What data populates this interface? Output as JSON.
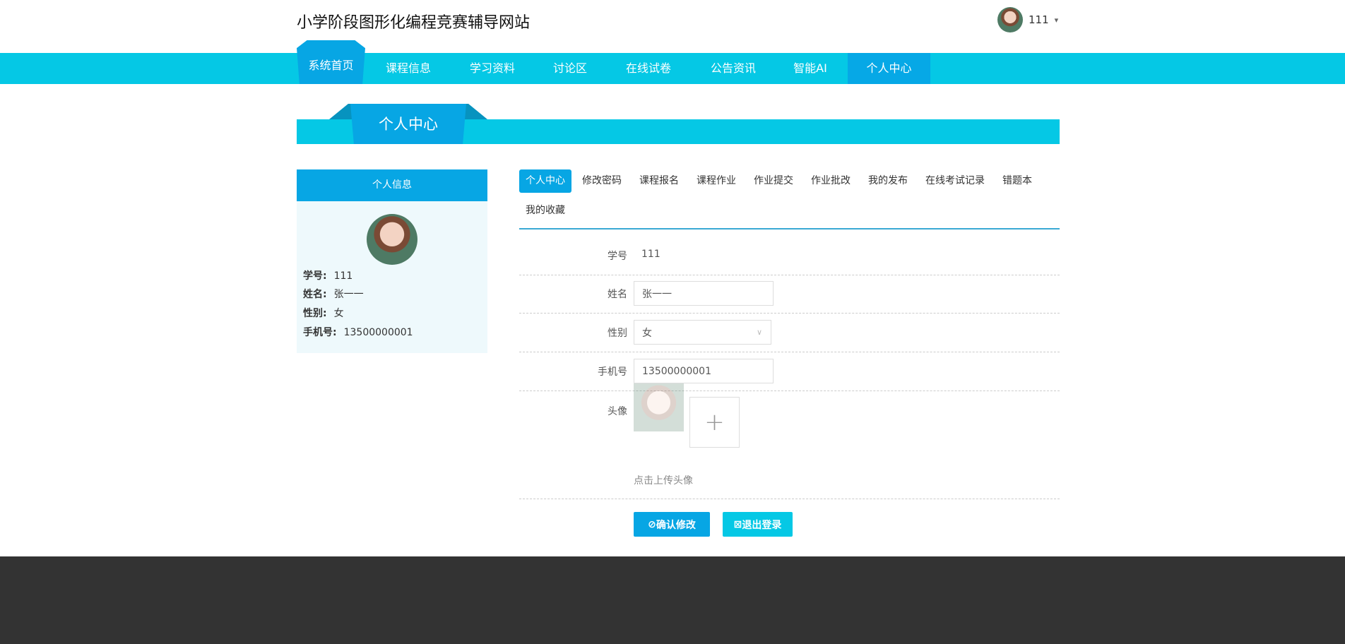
{
  "header": {
    "title": "小学阶段图形化编程竞赛辅导网站",
    "username": "111",
    "caret": "▾"
  },
  "nav": {
    "items": [
      "系统首页",
      "课程信息",
      "学习资料",
      "讨论区",
      "在线试卷",
      "公告资讯",
      "智能AI",
      "个人中心"
    ],
    "active": "个人中心"
  },
  "banner": {
    "title": "个人中心"
  },
  "profile": {
    "heading": "个人信息",
    "rows": [
      {
        "label": "学号:",
        "value": "111"
      },
      {
        "label": "姓名:",
        "value": "张一一"
      },
      {
        "label": "性别:",
        "value": "女"
      },
      {
        "label": "手机号:",
        "value": "13500000001"
      }
    ]
  },
  "tabs": [
    "个人中心",
    "修改密码",
    "课程报名",
    "课程作业",
    "作业提交",
    "作业批改",
    "我的发布",
    "在线考试记录",
    "错题本",
    "我的收藏"
  ],
  "form": {
    "id_label": "学号",
    "id_value": "111",
    "name_label": "姓名",
    "name_value": "张一一",
    "gender_label": "性别",
    "gender_value": "女",
    "phone_label": "手机号",
    "phone_value": "13500000001",
    "avatar_label": "头像",
    "upload_hint": "点击上传头像",
    "confirm": "确认修改",
    "logout": "退出登录"
  },
  "colors": {
    "primary": "#07a6e4",
    "nav": "#05c8e5",
    "footer": "#333333"
  }
}
